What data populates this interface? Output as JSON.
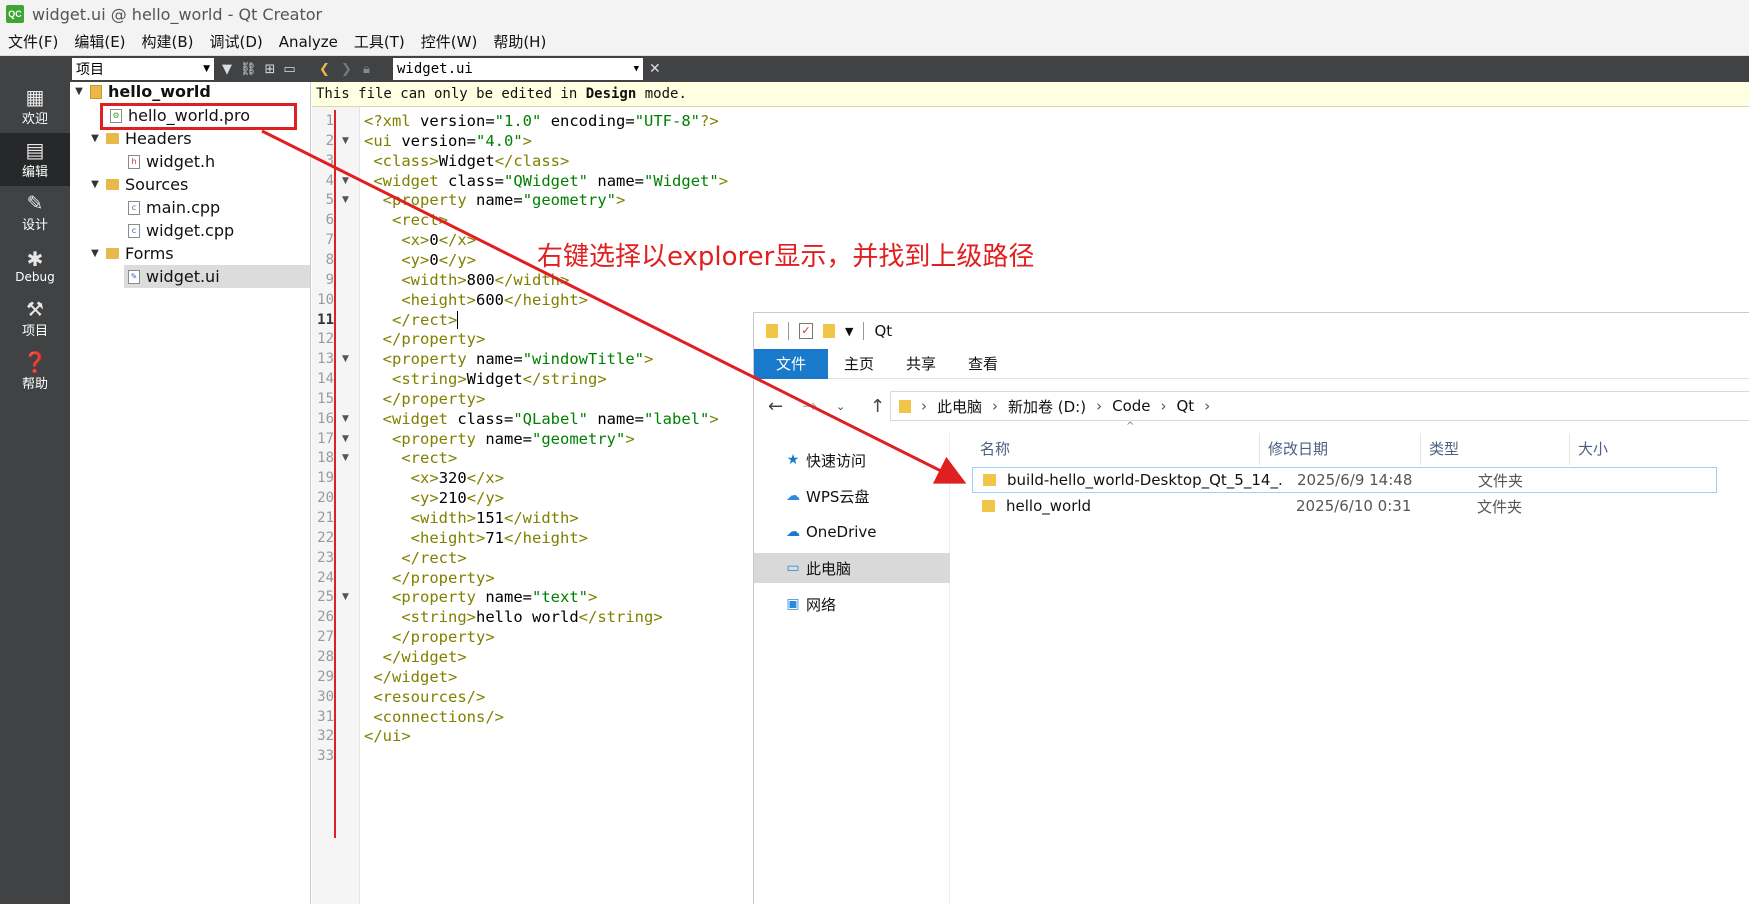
{
  "window": {
    "title": "widget.ui @ hello_world - Qt Creator",
    "logo": "QC"
  },
  "menu": [
    "文件(F)",
    "编辑(E)",
    "构建(B)",
    "调试(D)",
    "Analyze",
    "工具(T)",
    "控件(W)",
    "帮助(H)"
  ],
  "modes": [
    {
      "label": "欢迎",
      "icon": "grid-icon"
    },
    {
      "label": "编辑",
      "icon": "edit-icon"
    },
    {
      "label": "设计",
      "icon": "pen-icon"
    },
    {
      "label": "Debug",
      "icon": "bug-icon"
    },
    {
      "label": "项目",
      "icon": "wrench-icon"
    },
    {
      "label": "帮助",
      "icon": "help-icon"
    }
  ],
  "project_panel": {
    "selector": "项目",
    "tree": {
      "root": "hello_world",
      "pro": "hello_world.pro",
      "headers": "Headers",
      "widget_h": "widget.h",
      "sources": "Sources",
      "main_cpp": "main.cpp",
      "widget_cpp": "widget.cpp",
      "forms": "Forms",
      "widget_ui": "widget.ui"
    }
  },
  "editor": {
    "file": "widget.ui",
    "info_pre": "This file can only be edited in ",
    "info_bold": "Design",
    "info_post": " mode.",
    "current_line": 11
  },
  "annotation": "右键选择以explorer显示，并找到上级路径",
  "explorer": {
    "title": "Qt",
    "ribbon": [
      "文件",
      "主页",
      "共享",
      "查看"
    ],
    "breadcrumb": [
      "此电脑",
      "新加卷 (D:)",
      "Code",
      "Qt"
    ],
    "nav": [
      "快速访问",
      "WPS云盘",
      "OneDrive",
      "此电脑",
      "网络"
    ],
    "columns": [
      "名称",
      "修改日期",
      "类型",
      "大小"
    ],
    "rows": [
      {
        "name": "build-hello_world-Desktop_Qt_5_14_...",
        "date": "2025/6/9 14:48",
        "type": "文件夹"
      },
      {
        "name": "hello_world",
        "date": "2025/6/10 0:31",
        "type": "文件夹"
      }
    ]
  },
  "colors": {
    "red_annotation": "#e02020",
    "tag": "#808000",
    "string": "#008000",
    "explorer_accent": "#1979ca"
  }
}
